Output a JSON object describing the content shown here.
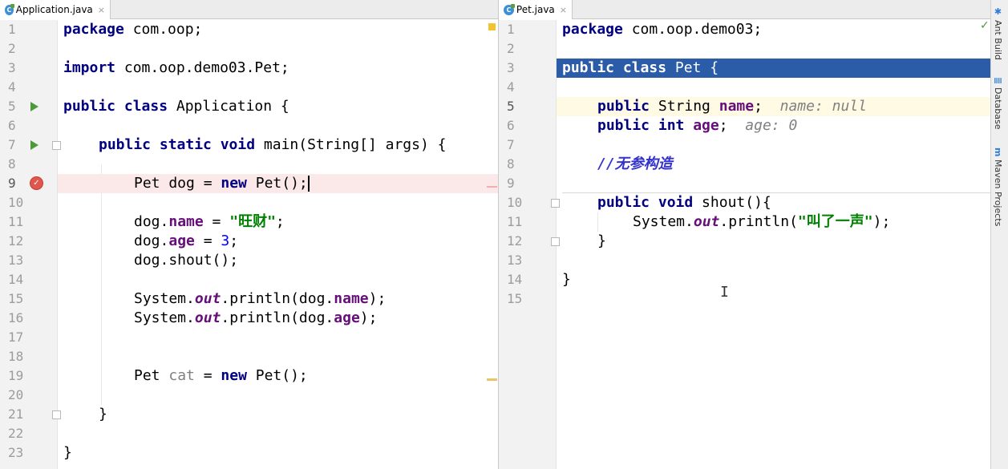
{
  "left": {
    "tab": {
      "name": "Application.java",
      "icon": "java-class-icon",
      "close": "×"
    },
    "line_numbers": [
      "1",
      "2",
      "3",
      "4",
      "5",
      "6",
      "7",
      "8",
      "9",
      "10",
      "11",
      "12",
      "13",
      "14",
      "15",
      "16",
      "17",
      "18",
      "19",
      "20",
      "21",
      "22",
      "23"
    ],
    "code": {
      "l1": {
        "kw": "package",
        "rest": " com.oop;"
      },
      "l3": {
        "kw": "import",
        "rest": " com.oop.demo03.Pet;"
      },
      "l5": {
        "kw": "public class",
        "rest": " Application {"
      },
      "l7": {
        "kw": "public static void",
        "rest": " main(String[] args) {"
      },
      "l9": {
        "a": "Pet dog = ",
        "kw": "new",
        "b": " Pet();"
      },
      "l11": {
        "a": "dog.",
        "field": "name",
        "b": " = ",
        "str": "\"旺财\"",
        "c": ";"
      },
      "l12": {
        "a": "dog.",
        "field": "age",
        "b": " = ",
        "num": "3",
        "c": ";"
      },
      "l13": {
        "a": "dog.shout();"
      },
      "l15": {
        "a": "System.",
        "static": "out",
        "b": ".println(dog.",
        "field": "name",
        "c": ");"
      },
      "l16": {
        "a": "System.",
        "static": "out",
        "b": ".println(dog.",
        "field": "age",
        "c": ");"
      },
      "l19": {
        "a": "Pet ",
        "unused": "cat",
        "b": " = ",
        "kw": "new",
        "c": " Pet();"
      },
      "l21": {
        "a": "}"
      },
      "l23": {
        "a": "}"
      }
    }
  },
  "right": {
    "tab": {
      "name": "Pet.java",
      "icon": "java-class-icon",
      "close": "×"
    },
    "line_numbers": [
      "1",
      "2",
      "3",
      "4",
      "5",
      "6",
      "7",
      "8",
      "9",
      "10",
      "11",
      "12",
      "13",
      "14",
      "15"
    ],
    "code": {
      "l1": {
        "kw": "package",
        "rest": " com.oop.demo03;"
      },
      "l3": {
        "kw": "public class",
        "rest": " Pet {"
      },
      "l5": {
        "kw": "public",
        "a": " String ",
        "field": "name",
        "b": ";",
        "hint": "name: null"
      },
      "l6": {
        "kw": "public int",
        "a": " ",
        "field": "age",
        "b": ";",
        "hint": "age: 0"
      },
      "l8": {
        "comment": "//无参构造"
      },
      "l10": {
        "kw": "public void",
        "rest": " shout(){"
      },
      "l11": {
        "a": "System.",
        "static": "out",
        "b": ".println(",
        "str": "\"叫了一声\"",
        "c": ");"
      },
      "l12": {
        "a": "}"
      },
      "l14": {
        "a": "}"
      }
    }
  },
  "side_tools": [
    {
      "label": "Ant Build",
      "icon": "ant-icon"
    },
    {
      "label": "Database",
      "icon": "database-icon"
    },
    {
      "label": "Maven Projects",
      "icon": "maven-icon"
    }
  ],
  "status": {
    "check": "✓"
  },
  "colors": {
    "selection": "#2a5ca8",
    "keyword": "#000080",
    "string": "#008000",
    "field": "#660e7a",
    "breakpoint": "#e0574f",
    "run": "#4c9a3a"
  }
}
